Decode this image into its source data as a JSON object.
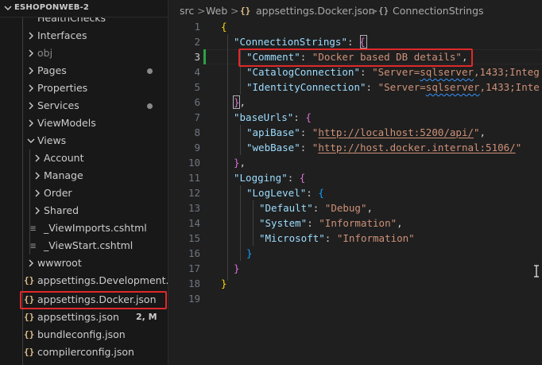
{
  "explorer": {
    "title": "ESHOPONWEB-2",
    "partial_item": "HealthChecks",
    "items": [
      {
        "label": "Interfaces",
        "kind": "folder"
      },
      {
        "label": "obj",
        "kind": "folder"
      },
      {
        "label": "Pages",
        "kind": "folder"
      },
      {
        "label": "Properties",
        "kind": "folder"
      },
      {
        "label": "Services",
        "kind": "folder"
      },
      {
        "label": "ViewModels",
        "kind": "folder"
      },
      {
        "label": "Views",
        "kind": "folder-open"
      },
      {
        "label": "Account",
        "kind": "folder"
      },
      {
        "label": "Manage",
        "kind": "folder"
      },
      {
        "label": "Order",
        "kind": "folder"
      },
      {
        "label": "Shared",
        "kind": "folder"
      },
      {
        "label": "_ViewImports.cshtml",
        "kind": "file-razor"
      },
      {
        "label": "_ViewStart.cshtml",
        "kind": "file-razor"
      },
      {
        "label": "wwwroot",
        "kind": "folder"
      },
      {
        "label": "appsettings.Development....",
        "kind": "file-json"
      },
      {
        "label": "appsettings.Docker.json",
        "kind": "file-json"
      },
      {
        "label": "appsettings.json",
        "kind": "file-json",
        "status": "2, M"
      },
      {
        "label": "bundleconfig.json",
        "kind": "file-json"
      },
      {
        "label": "compilerconfig.json",
        "kind": "file-json"
      }
    ]
  },
  "icons": {
    "json_file": "json-file-icon",
    "razor_file": "razor-file-icon",
    "chevron_right": "chevron-right-icon",
    "chevron_down": "chevron-down-icon",
    "json_glyph": "{}",
    "razor_glyph": "≡"
  },
  "breadcrumb": {
    "parts": [
      "src",
      "Web",
      "appsettings.Docker.json",
      "ConnectionStrings"
    ],
    "separator": ">"
  },
  "editor": {
    "active_line": 3,
    "line_numbers": [
      "1",
      "2",
      "3",
      "4",
      "5",
      "6",
      "7",
      "8",
      "9",
      "10",
      "11",
      "12",
      "13",
      "14",
      "15",
      "16",
      "17",
      "18",
      "19"
    ],
    "tokens": {
      "l1": "{",
      "l2_key": "\"ConnectionStrings\"",
      "l2_colon": ": ",
      "l2_brace": "{",
      "l3_key": "\"Comment\"",
      "l3_colon": ": ",
      "l3_val": "\"Docker based DB details\"",
      "l3_comma": ",",
      "l4_key": "\"CatalogConnection\"",
      "l4_colon": ": ",
      "l4_val_a": "\"Server=",
      "l4_val_b": "sqlserver",
      "l4_val_c": ",1433;Integ",
      "l5_key": "\"IdentityConnection\"",
      "l5_colon": ": ",
      "l5_val_a": "\"Server=",
      "l5_val_b": "sqlserver",
      "l5_val_c": ",1433;Inte",
      "l6_brace": "}",
      "l6_comma": ",",
      "l7_key": "\"baseUrls\"",
      "l7_colon": ": ",
      "l7_brace": "{",
      "l8_key": "\"apiBase\"",
      "l8_colon": ": ",
      "l8_q1": "\"",
      "l8_url": "http://localhost:5200/api/",
      "l8_q2": "\"",
      "l8_comma": ",",
      "l9_key": "\"webBase\"",
      "l9_colon": ": ",
      "l9_q1": "\"",
      "l9_url": "http://host.docker.internal:5106/",
      "l9_q2": "\"",
      "l10_brace": "}",
      "l10_comma": ",",
      "l11_key": "\"Logging\"",
      "l11_colon": ": ",
      "l11_brace": "{",
      "l12_key": "\"LogLevel\"",
      "l12_colon": ": ",
      "l12_brace": "{",
      "l13_key": "\"Default\"",
      "l13_colon": ": ",
      "l13_val": "\"Debug\"",
      "l13_comma": ",",
      "l14_key": "\"System\"",
      "l14_colon": ": ",
      "l14_val": "\"Information\"",
      "l14_comma": ",",
      "l15_key": "\"Microsoft\"",
      "l15_colon": ": ",
      "l15_val": "\"Information\"",
      "l16_brace": "}",
      "l17_brace": "}",
      "l18_brace": "}"
    }
  },
  "colors": {
    "highlight_box": "#e0292a",
    "json_key": "#9cdcfe",
    "json_string": "#ce9178",
    "bracket_level1": "#ffd700",
    "bracket_level2": "#da70d6",
    "bracket_level3": "#179fff",
    "modified_bar": "#2ea043",
    "squiggle": "#3794ff"
  }
}
